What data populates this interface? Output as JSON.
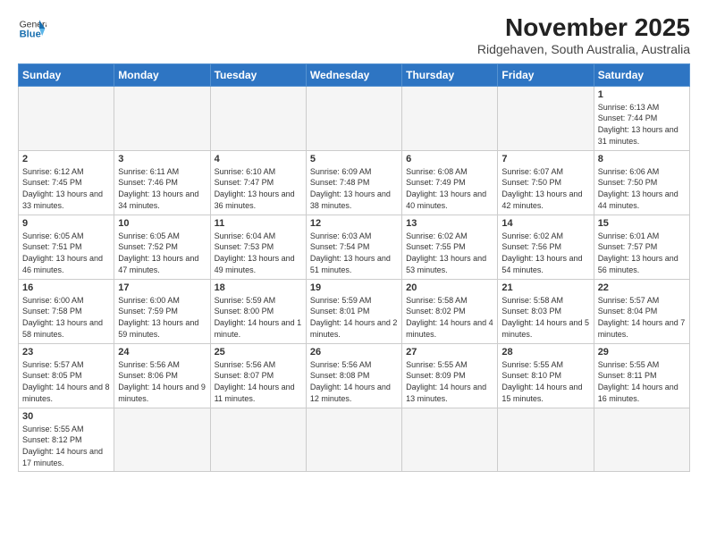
{
  "header": {
    "logo_general": "General",
    "logo_blue": "Blue",
    "month_title": "November 2025",
    "location": "Ridgehaven, South Australia, Australia"
  },
  "weekdays": [
    "Sunday",
    "Monday",
    "Tuesday",
    "Wednesday",
    "Thursday",
    "Friday",
    "Saturday"
  ],
  "weeks": [
    [
      {
        "day": "",
        "info": ""
      },
      {
        "day": "",
        "info": ""
      },
      {
        "day": "",
        "info": ""
      },
      {
        "day": "",
        "info": ""
      },
      {
        "day": "",
        "info": ""
      },
      {
        "day": "",
        "info": ""
      },
      {
        "day": "1",
        "info": "Sunrise: 6:13 AM\nSunset: 7:44 PM\nDaylight: 13 hours\nand 31 minutes."
      }
    ],
    [
      {
        "day": "2",
        "info": "Sunrise: 6:12 AM\nSunset: 7:45 PM\nDaylight: 13 hours\nand 33 minutes."
      },
      {
        "day": "3",
        "info": "Sunrise: 6:11 AM\nSunset: 7:46 PM\nDaylight: 13 hours\nand 34 minutes."
      },
      {
        "day": "4",
        "info": "Sunrise: 6:10 AM\nSunset: 7:47 PM\nDaylight: 13 hours\nand 36 minutes."
      },
      {
        "day": "5",
        "info": "Sunrise: 6:09 AM\nSunset: 7:48 PM\nDaylight: 13 hours\nand 38 minutes."
      },
      {
        "day": "6",
        "info": "Sunrise: 6:08 AM\nSunset: 7:49 PM\nDaylight: 13 hours\nand 40 minutes."
      },
      {
        "day": "7",
        "info": "Sunrise: 6:07 AM\nSunset: 7:50 PM\nDaylight: 13 hours\nand 42 minutes."
      },
      {
        "day": "8",
        "info": "Sunrise: 6:06 AM\nSunset: 7:50 PM\nDaylight: 13 hours\nand 44 minutes."
      }
    ],
    [
      {
        "day": "9",
        "info": "Sunrise: 6:05 AM\nSunset: 7:51 PM\nDaylight: 13 hours\nand 46 minutes."
      },
      {
        "day": "10",
        "info": "Sunrise: 6:05 AM\nSunset: 7:52 PM\nDaylight: 13 hours\nand 47 minutes."
      },
      {
        "day": "11",
        "info": "Sunrise: 6:04 AM\nSunset: 7:53 PM\nDaylight: 13 hours\nand 49 minutes."
      },
      {
        "day": "12",
        "info": "Sunrise: 6:03 AM\nSunset: 7:54 PM\nDaylight: 13 hours\nand 51 minutes."
      },
      {
        "day": "13",
        "info": "Sunrise: 6:02 AM\nSunset: 7:55 PM\nDaylight: 13 hours\nand 53 minutes."
      },
      {
        "day": "14",
        "info": "Sunrise: 6:02 AM\nSunset: 7:56 PM\nDaylight: 13 hours\nand 54 minutes."
      },
      {
        "day": "15",
        "info": "Sunrise: 6:01 AM\nSunset: 7:57 PM\nDaylight: 13 hours\nand 56 minutes."
      }
    ],
    [
      {
        "day": "16",
        "info": "Sunrise: 6:00 AM\nSunset: 7:58 PM\nDaylight: 13 hours\nand 58 minutes."
      },
      {
        "day": "17",
        "info": "Sunrise: 6:00 AM\nSunset: 7:59 PM\nDaylight: 13 hours\nand 59 minutes."
      },
      {
        "day": "18",
        "info": "Sunrise: 5:59 AM\nSunset: 8:00 PM\nDaylight: 14 hours\nand 1 minute."
      },
      {
        "day": "19",
        "info": "Sunrise: 5:59 AM\nSunset: 8:01 PM\nDaylight: 14 hours\nand 2 minutes."
      },
      {
        "day": "20",
        "info": "Sunrise: 5:58 AM\nSunset: 8:02 PM\nDaylight: 14 hours\nand 4 minutes."
      },
      {
        "day": "21",
        "info": "Sunrise: 5:58 AM\nSunset: 8:03 PM\nDaylight: 14 hours\nand 5 minutes."
      },
      {
        "day": "22",
        "info": "Sunrise: 5:57 AM\nSunset: 8:04 PM\nDaylight: 14 hours\nand 7 minutes."
      }
    ],
    [
      {
        "day": "23",
        "info": "Sunrise: 5:57 AM\nSunset: 8:05 PM\nDaylight: 14 hours\nand 8 minutes."
      },
      {
        "day": "24",
        "info": "Sunrise: 5:56 AM\nSunset: 8:06 PM\nDaylight: 14 hours\nand 9 minutes."
      },
      {
        "day": "25",
        "info": "Sunrise: 5:56 AM\nSunset: 8:07 PM\nDaylight: 14 hours\nand 11 minutes."
      },
      {
        "day": "26",
        "info": "Sunrise: 5:56 AM\nSunset: 8:08 PM\nDaylight: 14 hours\nand 12 minutes."
      },
      {
        "day": "27",
        "info": "Sunrise: 5:55 AM\nSunset: 8:09 PM\nDaylight: 14 hours\nand 13 minutes."
      },
      {
        "day": "28",
        "info": "Sunrise: 5:55 AM\nSunset: 8:10 PM\nDaylight: 14 hours\nand 15 minutes."
      },
      {
        "day": "29",
        "info": "Sunrise: 5:55 AM\nSunset: 8:11 PM\nDaylight: 14 hours\nand 16 minutes."
      }
    ],
    [
      {
        "day": "30",
        "info": "Sunrise: 5:55 AM\nSunset: 8:12 PM\nDaylight: 14 hours\nand 17 minutes."
      },
      {
        "day": "",
        "info": ""
      },
      {
        "day": "",
        "info": ""
      },
      {
        "day": "",
        "info": ""
      },
      {
        "day": "",
        "info": ""
      },
      {
        "day": "",
        "info": ""
      },
      {
        "day": "",
        "info": ""
      }
    ]
  ]
}
